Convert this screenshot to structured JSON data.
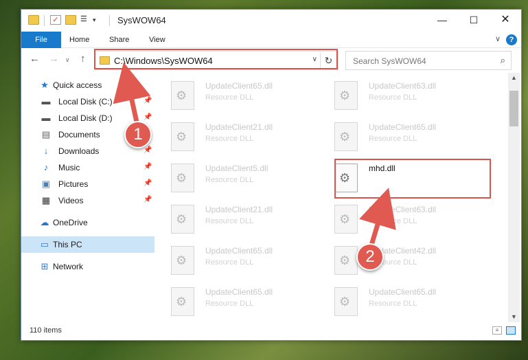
{
  "window": {
    "title": "SysWOW64",
    "minimize": "—",
    "maximize": "☐",
    "close": "✕"
  },
  "quick_access_toolbar": {
    "check_glyph": "✓",
    "props_glyph": "☰",
    "down_glyph": "▾"
  },
  "ribbon": {
    "tabs": [
      "File",
      "Home",
      "Share",
      "View"
    ],
    "expand_glyph": "∨",
    "help_glyph": "?"
  },
  "navigation": {
    "back_glyph": "←",
    "forward_glyph": "→",
    "recent_glyph": "∨",
    "up_glyph": "↑",
    "address": "C:\\Windows\\SysWOW64",
    "address_dropdown": "∨",
    "refresh_glyph": "↻",
    "search_placeholder": "Search SysWOW64",
    "search_glyph": "⌕"
  },
  "sidebar": {
    "items": [
      {
        "label": "Quick access",
        "icon": "star-icon",
        "glyph": "★"
      },
      {
        "label": "Local Disk (C:)",
        "icon": "disk-icon",
        "glyph": "▬",
        "pinned": "📌"
      },
      {
        "label": "Local Disk (D:)",
        "icon": "disk-icon",
        "glyph": "▬",
        "pinned": "📌"
      },
      {
        "label": "Documents",
        "icon": "document-icon",
        "glyph": "▤",
        "pinned": "📌"
      },
      {
        "label": "Downloads",
        "icon": "download-icon",
        "glyph": "↓",
        "pinned": "📌"
      },
      {
        "label": "Music",
        "icon": "music-icon",
        "glyph": "♪",
        "pinned": "📌"
      },
      {
        "label": "Pictures",
        "icon": "picture-icon",
        "glyph": "▣",
        "pinned": "📌"
      },
      {
        "label": "Videos",
        "icon": "video-icon",
        "glyph": "▦",
        "pinned": "📌"
      },
      {
        "label": "OneDrive",
        "icon": "cloud-icon",
        "glyph": "☁"
      },
      {
        "label": "This PC",
        "icon": "computer-icon",
        "glyph": "▭"
      },
      {
        "label": "Network",
        "icon": "network-icon",
        "glyph": "⊞"
      }
    ]
  },
  "files": [
    {
      "name": "UpdateClient65.dll",
      "type": "Resource DLL"
    },
    {
      "name": "UpdateClient63.dll",
      "type": "Resource DLL"
    },
    {
      "name": "UpdateClient21.dll",
      "type": "Resource DLL"
    },
    {
      "name": "UpdateClient65.dll",
      "type": "Resource DLL"
    },
    {
      "name": "UpdateClient5.dll",
      "type": "Resource DLL"
    },
    {
      "name": "mhd.dll",
      "type": ""
    },
    {
      "name": "UpdateClient21.dll",
      "type": "Resource DLL"
    },
    {
      "name": "UpdateClient63.dll",
      "type": "Resource DLL"
    },
    {
      "name": "UpdateClient65.dll",
      "type": "Resource DLL"
    },
    {
      "name": "UpdateClient42.dll",
      "type": "Resource DLL"
    },
    {
      "name": "UpdateClient65.dll",
      "type": "Resource DLL"
    },
    {
      "name": "UpdateClient65.dll",
      "type": "Resource DLL"
    }
  ],
  "scrollbar": {
    "up": "▲",
    "down": "▼"
  },
  "status": {
    "item_count": "110 items",
    "details_glyph": "≡"
  },
  "annotations": {
    "step1": "1",
    "step2": "2"
  },
  "colors": {
    "accent": "#1979ca",
    "annotation_red": "#d9534f",
    "selection": "#cce4f7"
  }
}
